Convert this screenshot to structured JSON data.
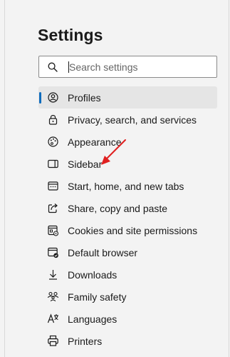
{
  "settings": {
    "title": "Settings"
  },
  "search": {
    "placeholder": "Search settings",
    "value": "",
    "icon": "search-icon"
  },
  "sidebar": {
    "items": [
      {
        "label": "Profiles",
        "icon": "profile-icon",
        "active": true
      },
      {
        "label": "Privacy, search, and services",
        "icon": "lock-icon",
        "active": false
      },
      {
        "label": "Appearance",
        "icon": "appearance-icon",
        "active": false
      },
      {
        "label": "Sidebar",
        "icon": "sidebar-icon",
        "active": false
      },
      {
        "label": "Start, home, and new tabs",
        "icon": "start-home-icon",
        "active": false
      },
      {
        "label": "Share, copy and paste",
        "icon": "share-icon",
        "active": false
      },
      {
        "label": "Cookies and site permissions",
        "icon": "cookies-icon",
        "active": false
      },
      {
        "label": "Default browser",
        "icon": "default-browser-icon",
        "active": false
      },
      {
        "label": "Downloads",
        "icon": "download-icon",
        "active": false
      },
      {
        "label": "Family safety",
        "icon": "family-icon",
        "active": false
      },
      {
        "label": "Languages",
        "icon": "languages-icon",
        "active": false
      },
      {
        "label": "Printers",
        "icon": "printer-icon",
        "active": false
      }
    ]
  },
  "colors": {
    "accent": "#0f6cbd",
    "annotation_arrow": "#e02020",
    "active_background": "#e5e5e5",
    "page_background": "#f3f3f3"
  }
}
